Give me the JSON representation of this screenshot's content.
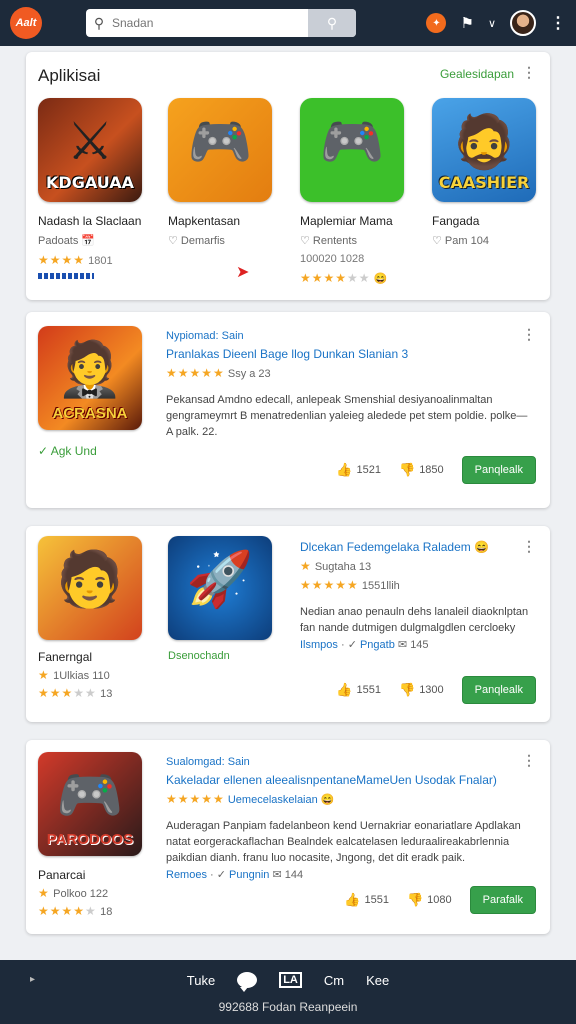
{
  "topbar": {
    "logo": "Aalt",
    "search_placeholder": "Snadan"
  },
  "apps": {
    "title": "Aplikisai",
    "link": "Gealesidapan",
    "items": [
      {
        "name": "Nadash la Slaclaan",
        "sub": "Padoats",
        "rating_text": "1801",
        "stars": 4,
        "art_label": "KDGAUAA"
      },
      {
        "name": "Mapkentasan",
        "sub": "Demarfis",
        "rating_text": "",
        "stars": 0,
        "art_label": ""
      },
      {
        "name": "Maplemiar Mama",
        "sub": "Rentents",
        "rating_text": "100020 1028",
        "stars": 3.5,
        "art_label": ""
      },
      {
        "name": "Fangada",
        "sub": "Pam 104",
        "rating_text": "",
        "stars": 0,
        "art_label": "CAASHIER"
      }
    ]
  },
  "feature1": {
    "label": "Nypiomad: Sain",
    "headline": "Pranlakas Dieenl Bage llog Dunkan Slanian 3",
    "rating_text": "Ssy a 23",
    "desc": "Pekansad Amdno edecall, anlepeak Smenshial desiyanoalinmaltan gengrameymrt B menatredenlian yaleieg aledede pet stem poldie. polke—A palk. 22.",
    "art_label": "ACRASNA",
    "caption": "Agk Und",
    "likes": "1521",
    "dislikes": "1850",
    "button": "Panqlealk"
  },
  "feature2": {
    "headline": "Dlcekan Fedemgelaka Raladem",
    "sub_rating": "Sugtaha 13",
    "rating_text": "1551llih",
    "desc": "Nedian anao penauln dehs lanaleil diaoknlptan fan nande dutmigen dulgmalgdlen cercloeky",
    "extra_a": "Ilsmpos",
    "extra_b": "Pngatb",
    "extra_c": "145",
    "left_name": "Fanerngal",
    "left_sub": "1Ulkias 110",
    "left_rating": "13",
    "mid_caption": "Dsenochadn",
    "likes": "1551",
    "dislikes": "1300",
    "button": "Panqlealk"
  },
  "feature3": {
    "label": "Sualomgad: Sain",
    "headline": "Kakeladar ellenen aleealisnpentaneMameUen Usodak Fnalar)",
    "sub_rating": "Uemecelaskelaian",
    "desc": "Auderagan Panpiam fadelanbeon kend Uernakriar eonariatlare Apdlakan natat eorgerackaflachan Bealndek ealcatelasen leduraalireakabrlennia paikdian dianh. franu luo nocasite, Jngong, det dit eradk paik.",
    "extra_a": "Remoes",
    "extra_b": "Pungnin",
    "extra_c": "144",
    "left_name": "Panarcai",
    "left_sub": "Polkoo 122",
    "left_rating": "18",
    "art_label": "PARODOOS",
    "likes": "1551",
    "dislikes": "1080",
    "button": "Parafalk"
  },
  "bottom_nav": {
    "item1": "Tuke",
    "item3": "LA",
    "item4": "Cm",
    "item5": "Kee",
    "caption": "992688 Fodan Reanpeein"
  }
}
